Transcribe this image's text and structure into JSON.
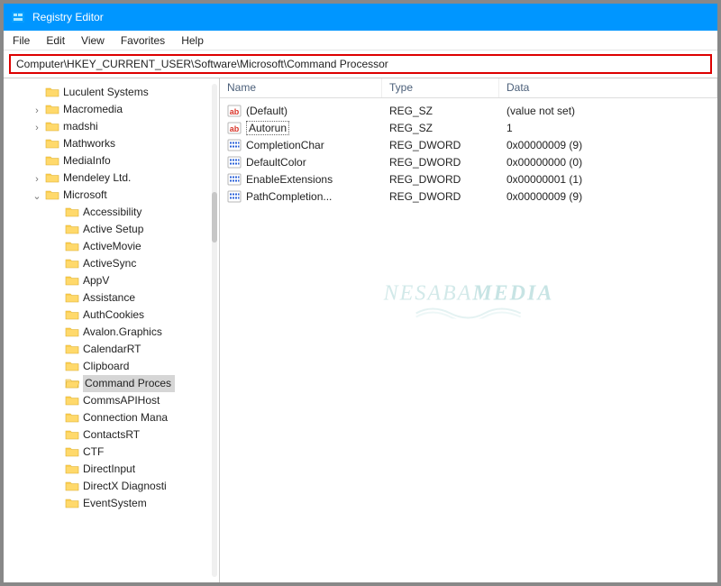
{
  "window": {
    "title": "Registry Editor"
  },
  "menubar": {
    "items": [
      "File",
      "Edit",
      "View",
      "Favorites",
      "Help"
    ]
  },
  "address": {
    "path": "Computer\\HKEY_CURRENT_USER\\Software\\Microsoft\\Command Processor"
  },
  "tree": {
    "items": [
      {
        "label": "Luculent Systems",
        "twisty": ""
      },
      {
        "label": "Macromedia",
        "twisty": ">"
      },
      {
        "label": "madshi",
        "twisty": ">"
      },
      {
        "label": "Mathworks",
        "twisty": ""
      },
      {
        "label": "MediaInfo",
        "twisty": ""
      },
      {
        "label": "Mendeley Ltd.",
        "twisty": ">"
      }
    ],
    "microsoft": {
      "label": "Microsoft",
      "twisty": "v"
    },
    "microsoft_children": [
      {
        "label": "Accessibility"
      },
      {
        "label": "Active Setup"
      },
      {
        "label": "ActiveMovie"
      },
      {
        "label": "ActiveSync"
      },
      {
        "label": "AppV"
      },
      {
        "label": "Assistance"
      },
      {
        "label": "AuthCookies"
      },
      {
        "label": "Avalon.Graphics"
      },
      {
        "label": "CalendarRT"
      },
      {
        "label": "Clipboard"
      },
      {
        "label": "Command Proces",
        "selected": true
      },
      {
        "label": "CommsAPIHost"
      },
      {
        "label": "Connection Mana"
      },
      {
        "label": "ContactsRT"
      },
      {
        "label": "CTF"
      },
      {
        "label": "DirectInput"
      },
      {
        "label": "DirectX Diagnosti"
      },
      {
        "label": "EventSystem"
      }
    ]
  },
  "list": {
    "columns": {
      "name": "Name",
      "type": "Type",
      "data": "Data"
    },
    "rows": [
      {
        "icon": "string",
        "name": "(Default)",
        "type": "REG_SZ",
        "data": "(value not set)"
      },
      {
        "icon": "string",
        "name": "Autorun",
        "type": "REG_SZ",
        "data": "1",
        "editing": true
      },
      {
        "icon": "dword",
        "name": "CompletionChar",
        "type": "REG_DWORD",
        "data": "0x00000009 (9)"
      },
      {
        "icon": "dword",
        "name": "DefaultColor",
        "type": "REG_DWORD",
        "data": "0x00000000 (0)"
      },
      {
        "icon": "dword",
        "name": "EnableExtensions",
        "type": "REG_DWORD",
        "data": "0x00000001 (1)"
      },
      {
        "icon": "dword",
        "name": "PathCompletion...",
        "type": "REG_DWORD",
        "data": "0x00000009 (9)"
      }
    ]
  },
  "watermark": {
    "part1": "NESABA",
    "part2": "MEDIA"
  }
}
